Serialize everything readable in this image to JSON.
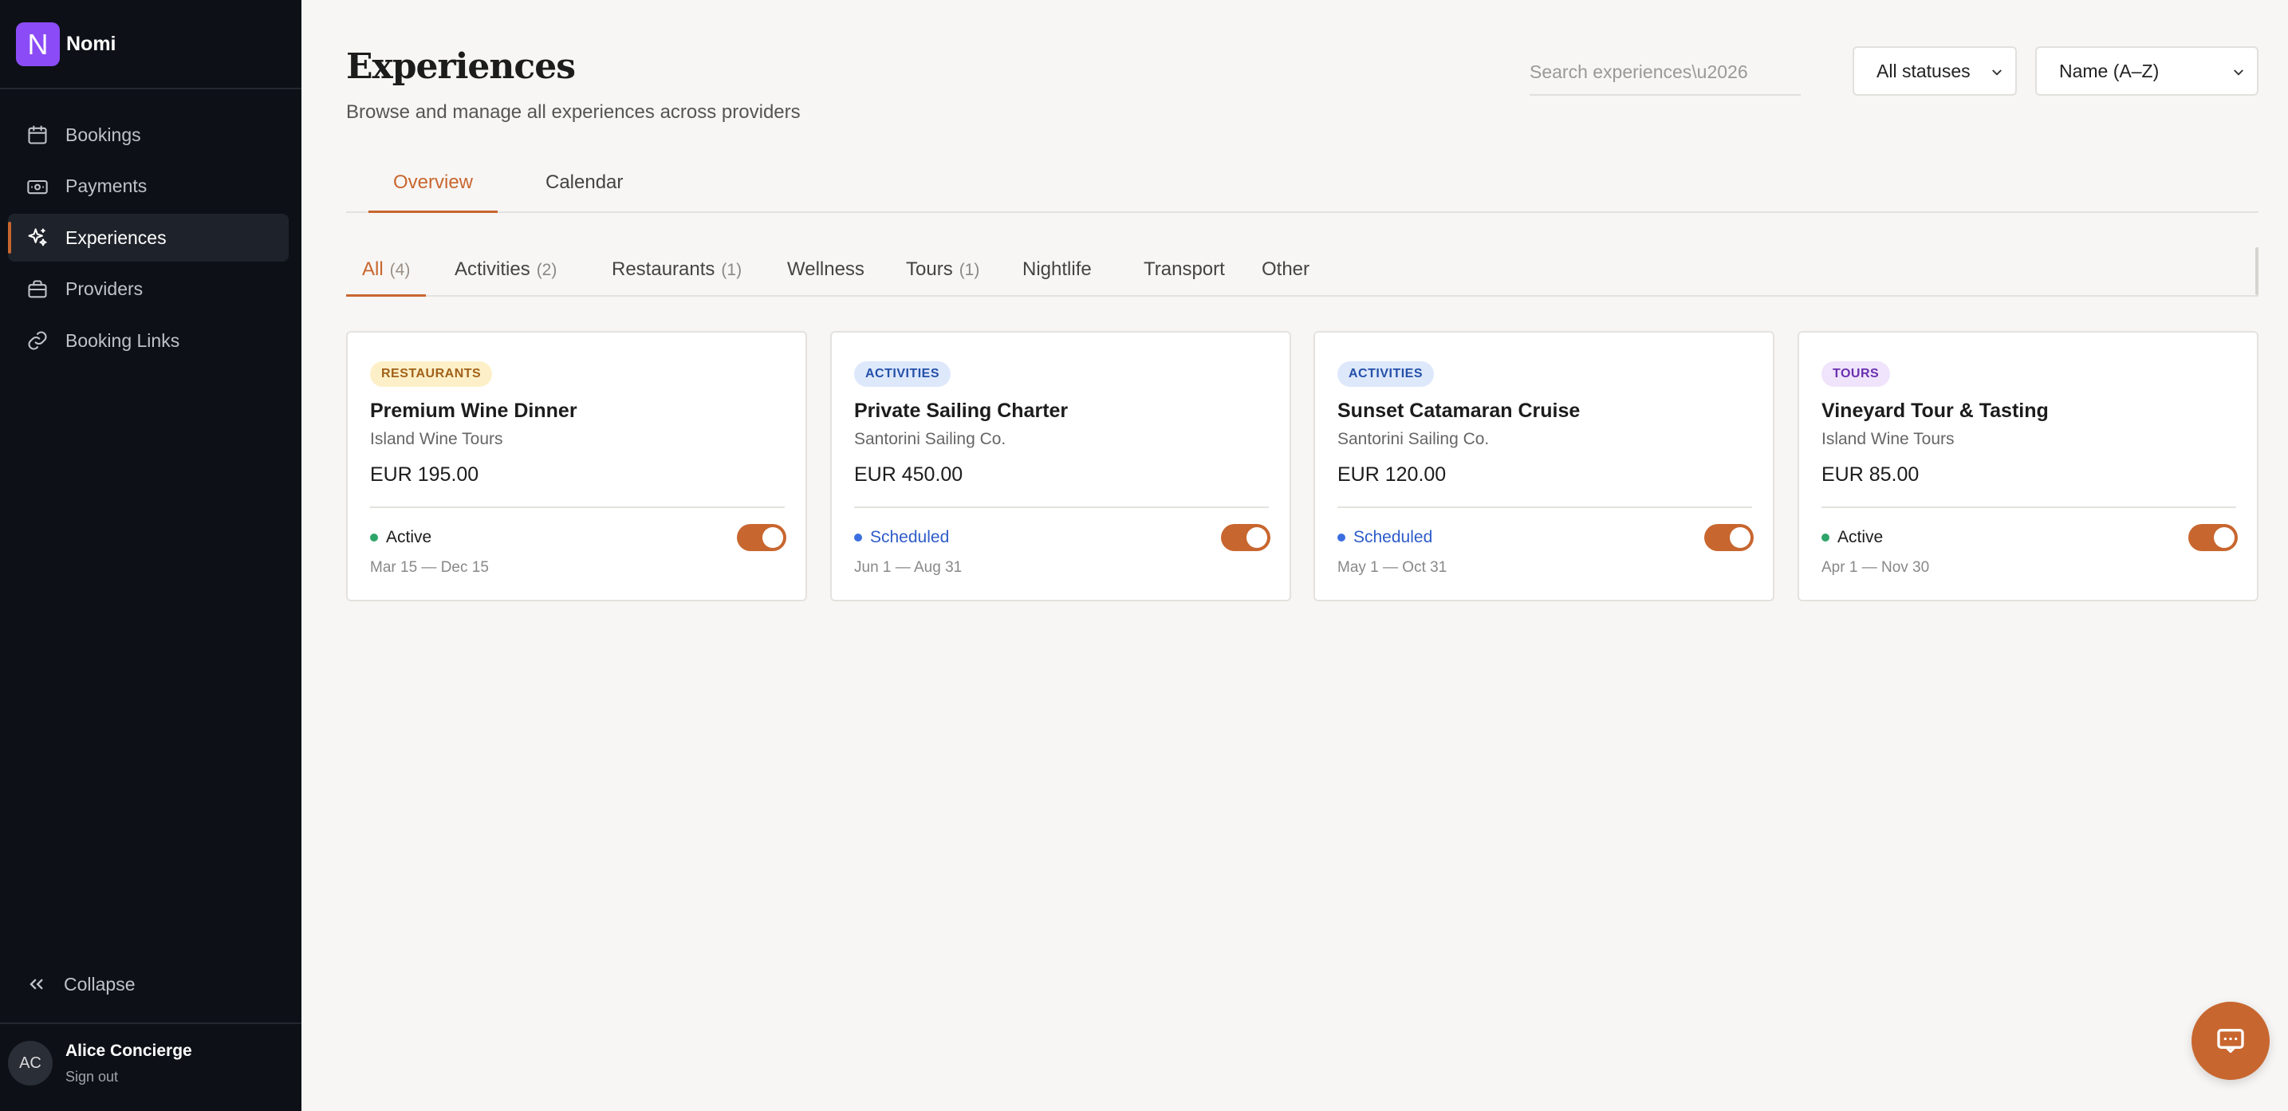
{
  "brand": {
    "logo_letter": "N",
    "name": "Nomi"
  },
  "sidebar": {
    "items": [
      {
        "label": "Bookings",
        "icon": "calendar-icon"
      },
      {
        "label": "Payments",
        "icon": "banknote-icon"
      },
      {
        "label": "Experiences",
        "icon": "sparkles-icon",
        "active": true
      },
      {
        "label": "Providers",
        "icon": "briefcase-icon"
      },
      {
        "label": "Booking Links",
        "icon": "link-icon"
      }
    ],
    "collapse_label": "Collapse",
    "user": {
      "initials": "AC",
      "name": "Alice Concierge",
      "sign_out": "Sign out"
    }
  },
  "header": {
    "title": "Experiences",
    "subtitle": "Browse and manage all experiences across providers",
    "search_placeholder": "Search experiences\\u2026",
    "status_filter": "All statuses",
    "sort": "Name (A–Z)"
  },
  "tabs": [
    {
      "label": "Overview",
      "active": true
    },
    {
      "label": "Calendar"
    }
  ],
  "categories": [
    {
      "label": "All",
      "count": "(4)",
      "active": true
    },
    {
      "label": "Activities",
      "count": "(2)"
    },
    {
      "label": "Restaurants",
      "count": "(1)"
    },
    {
      "label": "Wellness",
      "count": ""
    },
    {
      "label": "Tours",
      "count": "(1)"
    },
    {
      "label": "Nightlife",
      "count": ""
    },
    {
      "label": "Transport",
      "count": ""
    },
    {
      "label": "Other",
      "count": ""
    }
  ],
  "cards": [
    {
      "badge": "RESTAURANTS",
      "badge_bg": "#fdf0c8",
      "badge_fg": "#a1621a",
      "title": "Premium Wine Dinner",
      "provider": "Island Wine Tours",
      "price": "EUR 195.00",
      "status": "Active",
      "status_color": "#2ea56a",
      "status_text_color": "#1c1c1c",
      "dates": "Mar 15 — Dec 15",
      "enabled": true
    },
    {
      "badge": "ACTIVITIES",
      "badge_bg": "#dde8fb",
      "badge_fg": "#2450a8",
      "title": "Private Sailing Charter",
      "provider": "Santorini Sailing Co.",
      "price": "EUR 450.00",
      "status": "Scheduled",
      "status_color": "#3b6fe0",
      "status_text_color": "#2d5bc9",
      "dates": "Jun 1 — Aug 31",
      "enabled": true
    },
    {
      "badge": "ACTIVITIES",
      "badge_bg": "#dde8fb",
      "badge_fg": "#2450a8",
      "title": "Sunset Catamaran Cruise",
      "provider": "Santorini Sailing Co.",
      "price": "EUR 120.00",
      "status": "Scheduled",
      "status_color": "#3b6fe0",
      "status_text_color": "#2d5bc9",
      "dates": "May 1 — Oct 31",
      "enabled": true
    },
    {
      "badge": "TOURS",
      "badge_bg": "#efe4fb",
      "badge_fg": "#6b2fb0",
      "title": "Vineyard Tour & Tasting",
      "provider": "Island Wine Tours",
      "price": "EUR 85.00",
      "status": "Active",
      "status_color": "#2ea56a",
      "status_text_color": "#1c1c1c",
      "dates": "Apr 1 — Nov 30",
      "enabled": true
    }
  ],
  "colors": {
    "accent": "#c8662f",
    "sidebar_bg": "#0d1117",
    "brand": "#8b4cf7"
  }
}
